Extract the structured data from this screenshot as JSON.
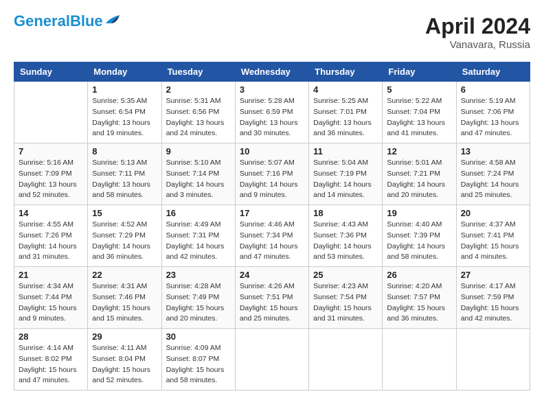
{
  "header": {
    "logo_line1": "General",
    "logo_line2": "Blue",
    "month": "April 2024",
    "location": "Vanavara, Russia"
  },
  "weekdays": [
    "Sunday",
    "Monday",
    "Tuesday",
    "Wednesday",
    "Thursday",
    "Friday",
    "Saturday"
  ],
  "weeks": [
    [
      {
        "day": "",
        "info": ""
      },
      {
        "day": "1",
        "info": "Sunrise: 5:35 AM\nSunset: 6:54 PM\nDaylight: 13 hours\nand 19 minutes."
      },
      {
        "day": "2",
        "info": "Sunrise: 5:31 AM\nSunset: 6:56 PM\nDaylight: 13 hours\nand 24 minutes."
      },
      {
        "day": "3",
        "info": "Sunrise: 5:28 AM\nSunset: 6:59 PM\nDaylight: 13 hours\nand 30 minutes."
      },
      {
        "day": "4",
        "info": "Sunrise: 5:25 AM\nSunset: 7:01 PM\nDaylight: 13 hours\nand 36 minutes."
      },
      {
        "day": "5",
        "info": "Sunrise: 5:22 AM\nSunset: 7:04 PM\nDaylight: 13 hours\nand 41 minutes."
      },
      {
        "day": "6",
        "info": "Sunrise: 5:19 AM\nSunset: 7:06 PM\nDaylight: 13 hours\nand 47 minutes."
      }
    ],
    [
      {
        "day": "7",
        "info": "Sunrise: 5:16 AM\nSunset: 7:09 PM\nDaylight: 13 hours\nand 52 minutes."
      },
      {
        "day": "8",
        "info": "Sunrise: 5:13 AM\nSunset: 7:11 PM\nDaylight: 13 hours\nand 58 minutes."
      },
      {
        "day": "9",
        "info": "Sunrise: 5:10 AM\nSunset: 7:14 PM\nDaylight: 14 hours\nand 3 minutes."
      },
      {
        "day": "10",
        "info": "Sunrise: 5:07 AM\nSunset: 7:16 PM\nDaylight: 14 hours\nand 9 minutes."
      },
      {
        "day": "11",
        "info": "Sunrise: 5:04 AM\nSunset: 7:19 PM\nDaylight: 14 hours\nand 14 minutes."
      },
      {
        "day": "12",
        "info": "Sunrise: 5:01 AM\nSunset: 7:21 PM\nDaylight: 14 hours\nand 20 minutes."
      },
      {
        "day": "13",
        "info": "Sunrise: 4:58 AM\nSunset: 7:24 PM\nDaylight: 14 hours\nand 25 minutes."
      }
    ],
    [
      {
        "day": "14",
        "info": "Sunrise: 4:55 AM\nSunset: 7:26 PM\nDaylight: 14 hours\nand 31 minutes."
      },
      {
        "day": "15",
        "info": "Sunrise: 4:52 AM\nSunset: 7:29 PM\nDaylight: 14 hours\nand 36 minutes."
      },
      {
        "day": "16",
        "info": "Sunrise: 4:49 AM\nSunset: 7:31 PM\nDaylight: 14 hours\nand 42 minutes."
      },
      {
        "day": "17",
        "info": "Sunrise: 4:46 AM\nSunset: 7:34 PM\nDaylight: 14 hours\nand 47 minutes."
      },
      {
        "day": "18",
        "info": "Sunrise: 4:43 AM\nSunset: 7:36 PM\nDaylight: 14 hours\nand 53 minutes."
      },
      {
        "day": "19",
        "info": "Sunrise: 4:40 AM\nSunset: 7:39 PM\nDaylight: 14 hours\nand 58 minutes."
      },
      {
        "day": "20",
        "info": "Sunrise: 4:37 AM\nSunset: 7:41 PM\nDaylight: 15 hours\nand 4 minutes."
      }
    ],
    [
      {
        "day": "21",
        "info": "Sunrise: 4:34 AM\nSunset: 7:44 PM\nDaylight: 15 hours\nand 9 minutes."
      },
      {
        "day": "22",
        "info": "Sunrise: 4:31 AM\nSunset: 7:46 PM\nDaylight: 15 hours\nand 15 minutes."
      },
      {
        "day": "23",
        "info": "Sunrise: 4:28 AM\nSunset: 7:49 PM\nDaylight: 15 hours\nand 20 minutes."
      },
      {
        "day": "24",
        "info": "Sunrise: 4:26 AM\nSunset: 7:51 PM\nDaylight: 15 hours\nand 25 minutes."
      },
      {
        "day": "25",
        "info": "Sunrise: 4:23 AM\nSunset: 7:54 PM\nDaylight: 15 hours\nand 31 minutes."
      },
      {
        "day": "26",
        "info": "Sunrise: 4:20 AM\nSunset: 7:57 PM\nDaylight: 15 hours\nand 36 minutes."
      },
      {
        "day": "27",
        "info": "Sunrise: 4:17 AM\nSunset: 7:59 PM\nDaylight: 15 hours\nand 42 minutes."
      }
    ],
    [
      {
        "day": "28",
        "info": "Sunrise: 4:14 AM\nSunset: 8:02 PM\nDaylight: 15 hours\nand 47 minutes."
      },
      {
        "day": "29",
        "info": "Sunrise: 4:11 AM\nSunset: 8:04 PM\nDaylight: 15 hours\nand 52 minutes."
      },
      {
        "day": "30",
        "info": "Sunrise: 4:09 AM\nSunset: 8:07 PM\nDaylight: 15 hours\nand 58 minutes."
      },
      {
        "day": "",
        "info": ""
      },
      {
        "day": "",
        "info": ""
      },
      {
        "day": "",
        "info": ""
      },
      {
        "day": "",
        "info": ""
      }
    ]
  ]
}
